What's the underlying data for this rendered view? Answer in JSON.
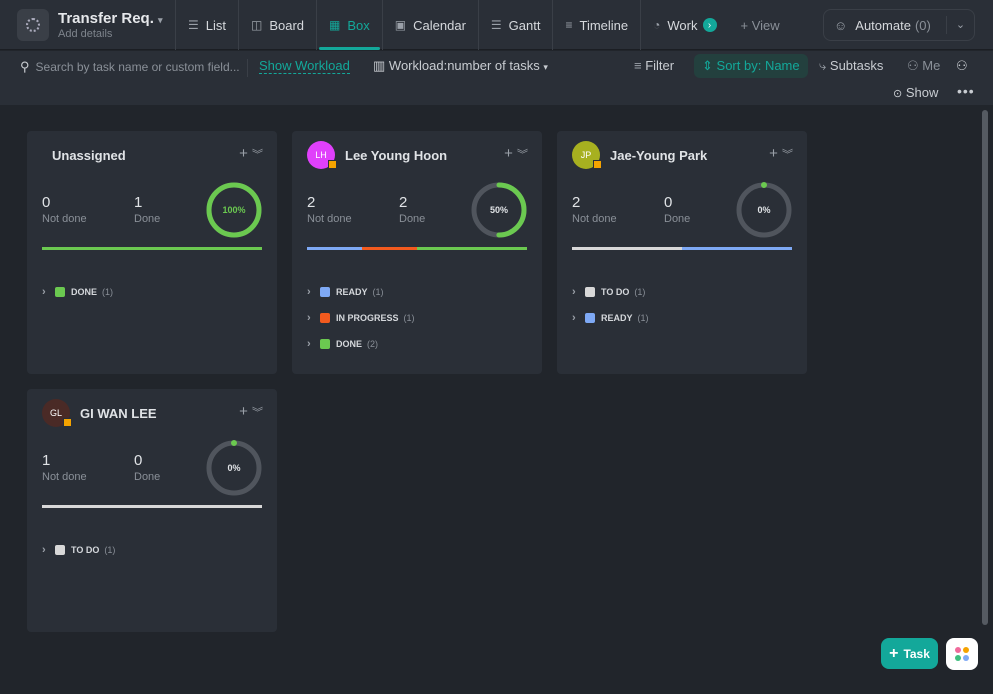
{
  "header": {
    "title": "Transfer Req.",
    "subtitle": "Add details",
    "tabs": [
      {
        "label": "List",
        "icon": "list-icon"
      },
      {
        "label": "Board",
        "icon": "board-icon"
      },
      {
        "label": "Box",
        "icon": "box-icon",
        "active": true
      },
      {
        "label": "Calendar",
        "icon": "calendar-icon"
      },
      {
        "label": "Gantt",
        "icon": "gantt-icon"
      },
      {
        "label": "Timeline",
        "icon": "timeline-icon"
      },
      {
        "label": "Work",
        "icon": "workload-icon"
      }
    ],
    "add_view": "+ View",
    "automate": "Automate",
    "automate_count": "(0)"
  },
  "toolbar": {
    "search_placeholder": "Search by task name or custom field...",
    "show_workload": "Show Workload",
    "workload": "Workload:number of tasks",
    "filter": "Filter",
    "sort": "Sort by: Name",
    "subtasks": "Subtasks",
    "me": "Me",
    "show": "Show"
  },
  "colors": {
    "accent": "#13a89a",
    "ready": "#7ea9f5",
    "in_progress": "#f25a1e",
    "done": "#6bc950",
    "todo": "#d8d8d8"
  },
  "cards": [
    {
      "name": "Unassigned",
      "initials": "",
      "avatar_color": "",
      "not_done": "0",
      "done": "1",
      "percent": 100,
      "percent_label": "100%",
      "not_done_label": "Not done",
      "done_label": "Done",
      "bar": [
        {
          "status": "done",
          "fraction": 1
        }
      ],
      "groups": [
        {
          "label": "DONE",
          "count": "(1)",
          "status": "done"
        }
      ]
    },
    {
      "name": "Lee Young Hoon",
      "initials": "LH",
      "avatar_color": "#e040fb",
      "not_done": "2",
      "done": "2",
      "percent": 50,
      "percent_label": "50%",
      "not_done_label": "Not done",
      "done_label": "Done",
      "bar": [
        {
          "status": "ready",
          "fraction": 0.25
        },
        {
          "status": "in_progress",
          "fraction": 0.25
        },
        {
          "status": "done",
          "fraction": 0.5
        }
      ],
      "groups": [
        {
          "label": "READY",
          "count": "(1)",
          "status": "ready"
        },
        {
          "label": "IN PROGRESS",
          "count": "(1)",
          "status": "in_progress"
        },
        {
          "label": "DONE",
          "count": "(2)",
          "status": "done"
        }
      ]
    },
    {
      "name": "Jae-Young Park",
      "initials": "JP",
      "avatar_color": "#a7b020",
      "not_done": "2",
      "done": "0",
      "percent": 0,
      "percent_label": "0%",
      "not_done_label": "Not done",
      "done_label": "Done",
      "bar": [
        {
          "status": "todo",
          "fraction": 0.5
        },
        {
          "status": "ready",
          "fraction": 0.5
        }
      ],
      "groups": [
        {
          "label": "TO DO",
          "count": "(1)",
          "status": "todo"
        },
        {
          "label": "READY",
          "count": "(1)",
          "status": "ready"
        }
      ]
    },
    {
      "name": "GI WAN LEE",
      "initials": "GL",
      "avatar_color": "#4a2a26",
      "not_done": "1",
      "done": "0",
      "percent": 0,
      "percent_label": "0%",
      "not_done_label": "Not done",
      "done_label": "Done",
      "bar": [
        {
          "status": "todo",
          "fraction": 1
        }
      ],
      "groups": [
        {
          "label": "TO DO",
          "count": "(1)",
          "status": "todo"
        }
      ]
    }
  ],
  "fab": {
    "task": "Task"
  }
}
